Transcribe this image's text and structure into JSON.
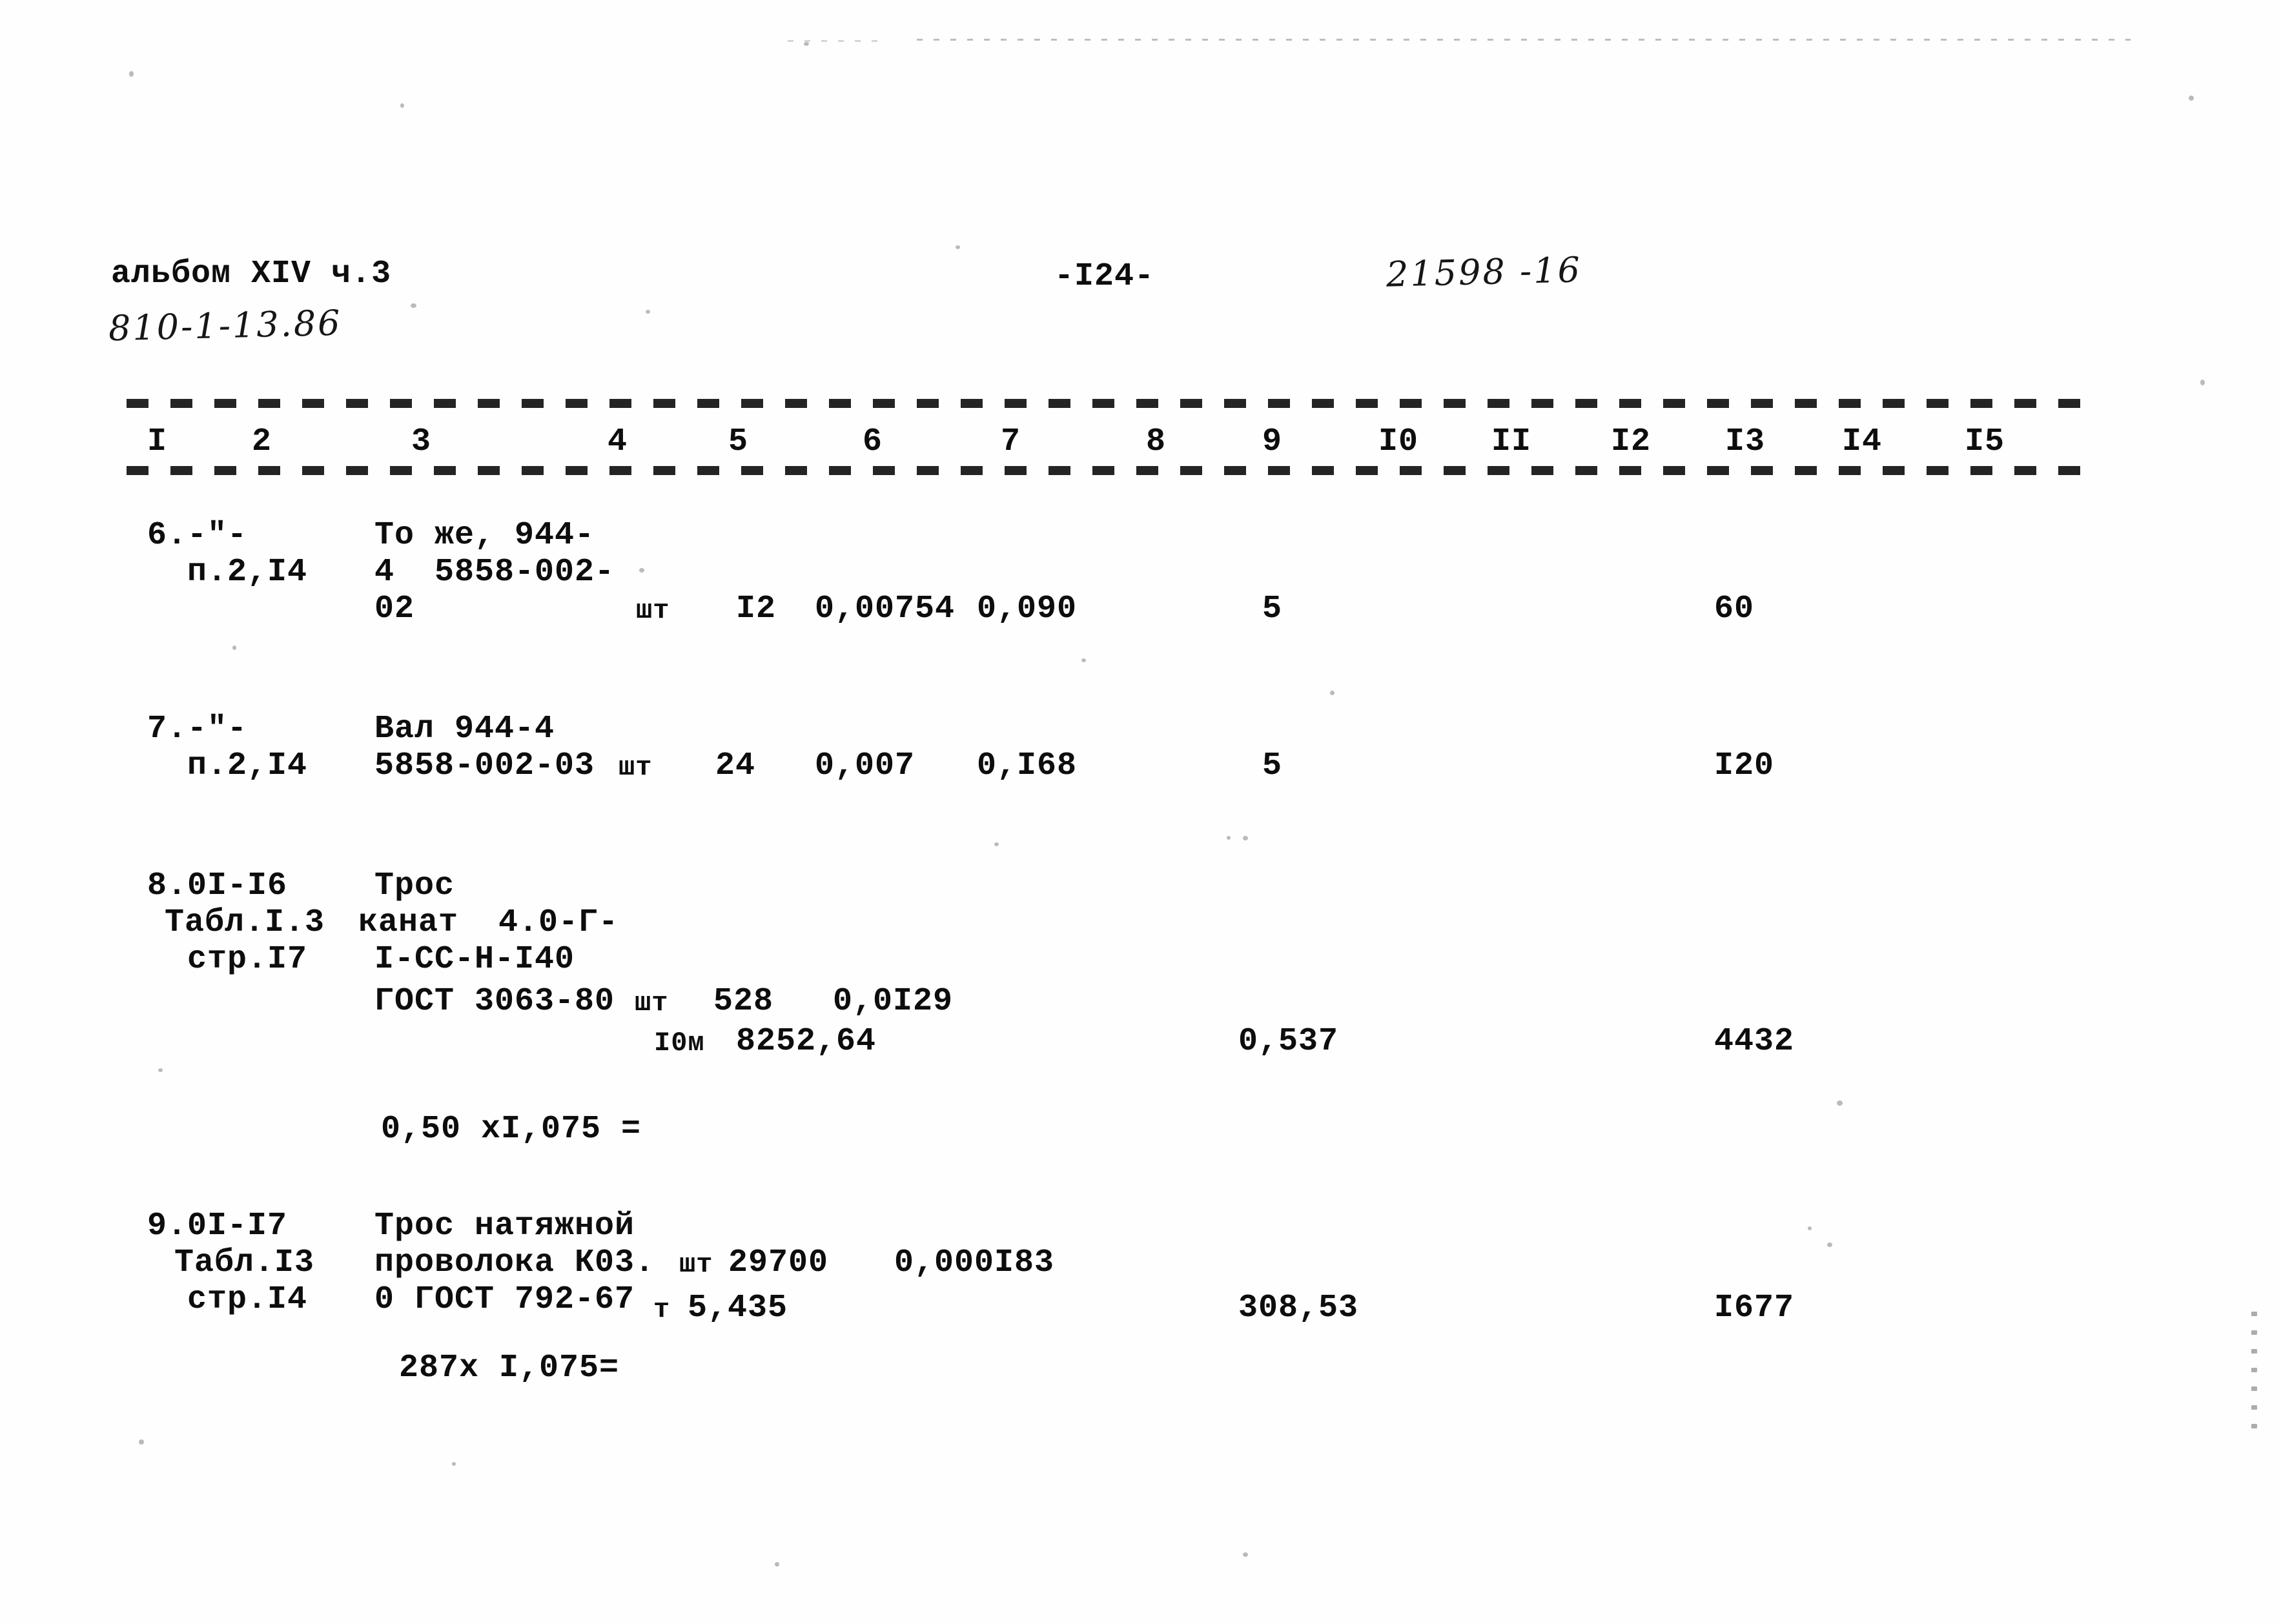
{
  "header": {
    "album_label": "альбом XIV ч.3",
    "album_code_handwritten": "810-1-13.86",
    "page_number": "-I24-",
    "doc_number_handwritten": "21598 -16"
  },
  "table": {
    "column_headers": [
      "I",
      "2",
      "3",
      "4",
      "5",
      "6",
      "7",
      "8",
      "9",
      "I0",
      "II",
      "I2",
      "I3",
      "I4",
      "I5"
    ],
    "rows": [
      {
        "id": "row-6",
        "col1": [
          "6.-\"-",
          "п.2,I4"
        ],
        "col3": [
          "То же, 944-",
          "4  5858-002-",
          "02"
        ],
        "col4": "шт",
        "col5": "I2",
        "col6": "0,00754",
        "col7": "0,090",
        "col9": "5",
        "col13": "60"
      },
      {
        "id": "row-7",
        "col1": [
          "7.-\"-",
          "п.2,I4"
        ],
        "col3": [
          "Вал 944-4",
          "5858-002-03"
        ],
        "col4": "шт",
        "col5": "24",
        "col6": "0,007",
        "col7": "0,I68",
        "col9": "5",
        "col13": "I20"
      },
      {
        "id": "row-8",
        "col1": [
          "8.0I-I6",
          "Табл.I.3",
          "стр.I7"
        ],
        "col3": [
          "Трос",
          "канат  4.0-Г-",
          "I-СС-Н-I40",
          "ГОСТ 3063-80"
        ],
        "col4": "шт",
        "col5": "528",
        "col6": "0,0I29",
        "col4b": "I0м",
        "col5b": "8252,64",
        "col9": "0,537",
        "col13": "4432",
        "note": "0,50 xI,075 ="
      },
      {
        "id": "row-9",
        "col1": [
          "9.0I-I7",
          "Табл.I3",
          "стр.I4"
        ],
        "col3": [
          "Трос натяжной",
          "проволока К03.",
          "0 ГОСТ 792-67"
        ],
        "col4": "шт",
        "col5": "29700",
        "col6": "0,000I83",
        "col4b": "т",
        "col5b": "5,435",
        "col9": "308,53",
        "col13": "I677",
        "note": "287х I,075="
      }
    ]
  }
}
